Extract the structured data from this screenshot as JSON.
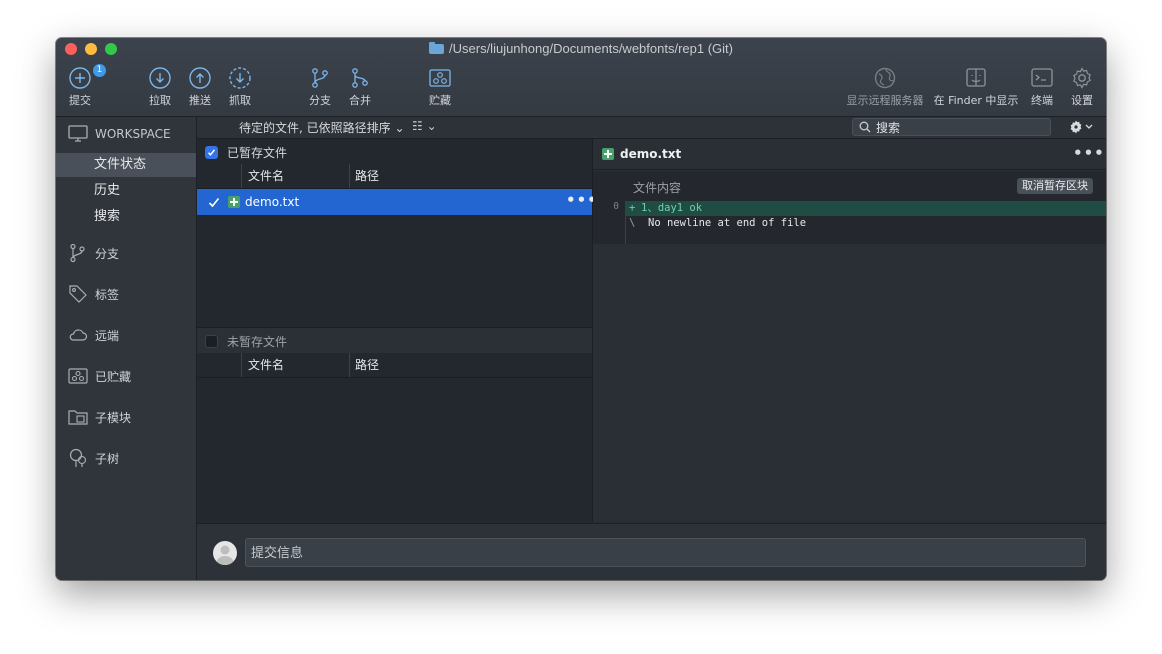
{
  "window": {
    "title": "/Users/liujunhong/Documents/webfonts/rep1 (Git)"
  },
  "toolbar": {
    "commit": {
      "label": "提交",
      "badge": "1"
    },
    "pull": "拉取",
    "push": "推送",
    "fetch": "抓取",
    "branch": "分支",
    "merge": "合并",
    "stash": "贮藏",
    "remote": "显示远程服务器",
    "finder": "在 Finder 中显示",
    "terminal": "终端",
    "settings": "设置"
  },
  "sidebar": {
    "workspace": "WORKSPACE",
    "workspace_items": [
      "文件状态",
      "历史",
      "搜索"
    ],
    "sections": [
      "分支",
      "标签",
      "远端",
      "已贮藏",
      "子模块",
      "子树"
    ]
  },
  "filterbar": {
    "sort": "待定的文件, 已依照路径排序",
    "search_placeholder": "搜索"
  },
  "staged": {
    "title": "已暂存文件",
    "col_name": "文件名",
    "col_path": "路径",
    "files": [
      {
        "name": "demo.txt"
      }
    ]
  },
  "unstaged": {
    "title": "未暂存文件",
    "col_name": "文件名",
    "col_path": "路径"
  },
  "diff": {
    "filename": "demo.txt",
    "hunk_title": "文件内容",
    "unstage_hunk": "取消暂存区块",
    "gutter_line": "0",
    "lines": [
      {
        "marker": "+",
        "text": "1、day1 ok"
      },
      {
        "marker": "\\",
        "text": "No newline at end of file"
      }
    ]
  },
  "commit": {
    "placeholder": "提交信息"
  },
  "colors": {
    "accent": "#2366d1",
    "added_bg": "#1f4d44",
    "added_fg": "#6fd0a8",
    "badge": "#3f9ae8"
  }
}
